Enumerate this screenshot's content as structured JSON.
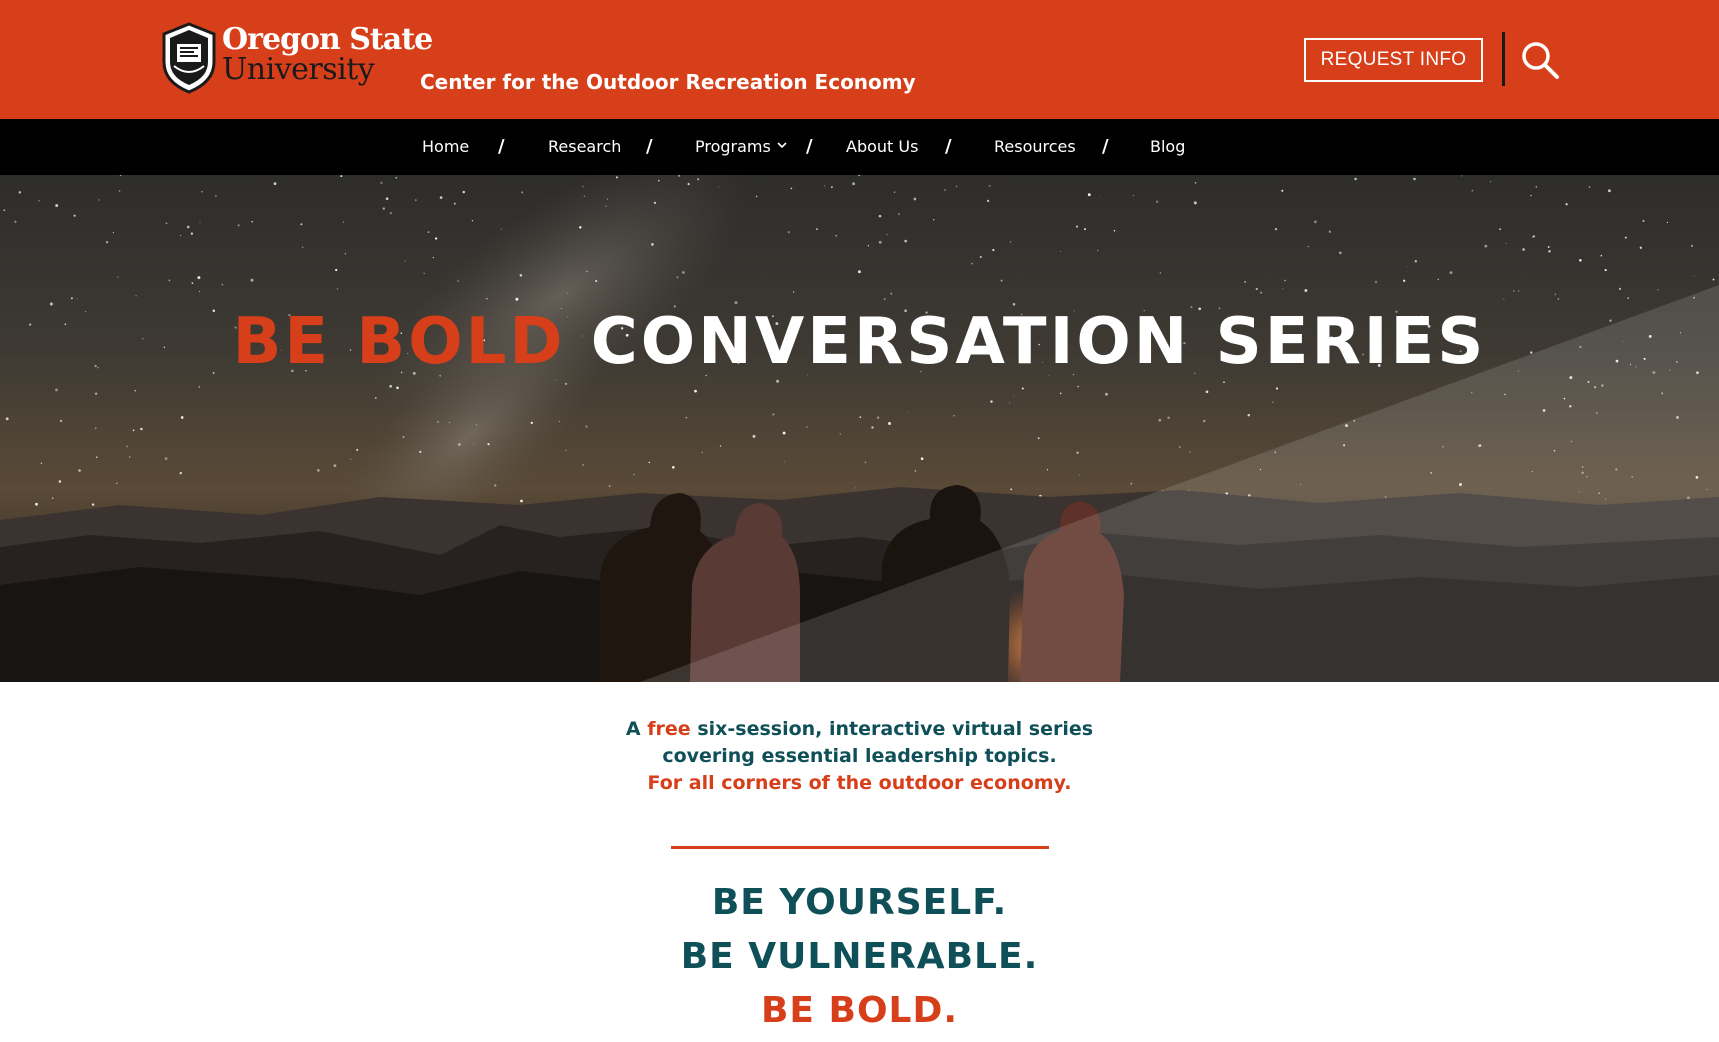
{
  "header": {
    "logo_line1": "Oregon State",
    "logo_line2": "University",
    "center_name": "Center for the Outdoor Recreation Economy",
    "request_info": "REQUEST INFO",
    "brand_color": "#d73f1a",
    "search_icon": "search-icon"
  },
  "nav": {
    "items": [
      {
        "label": "Home"
      },
      {
        "label": "Research"
      },
      {
        "label": "Programs",
        "has_dropdown": true
      },
      {
        "label": "About Us"
      },
      {
        "label": "Resources"
      },
      {
        "label": "Blog"
      }
    ],
    "separator": "/"
  },
  "hero": {
    "title_highlight": "BE BOLD",
    "title_rest": "CONVERSATION SERIES"
  },
  "intro": {
    "line1_a": "A",
    "line1_free": "free",
    "line1_b": "six-session, interactive virtual series",
    "line2": "covering essential leadership topics.",
    "line3": "For all corners of the outdoor economy."
  },
  "tagline": {
    "line1": "BE YOURSELF.",
    "line2": "BE VULNERABLE.",
    "line3": "BE BOLD."
  },
  "colors": {
    "teal": "#0f5058",
    "orange": "#d73f1a",
    "nav_bg": "#000000"
  }
}
